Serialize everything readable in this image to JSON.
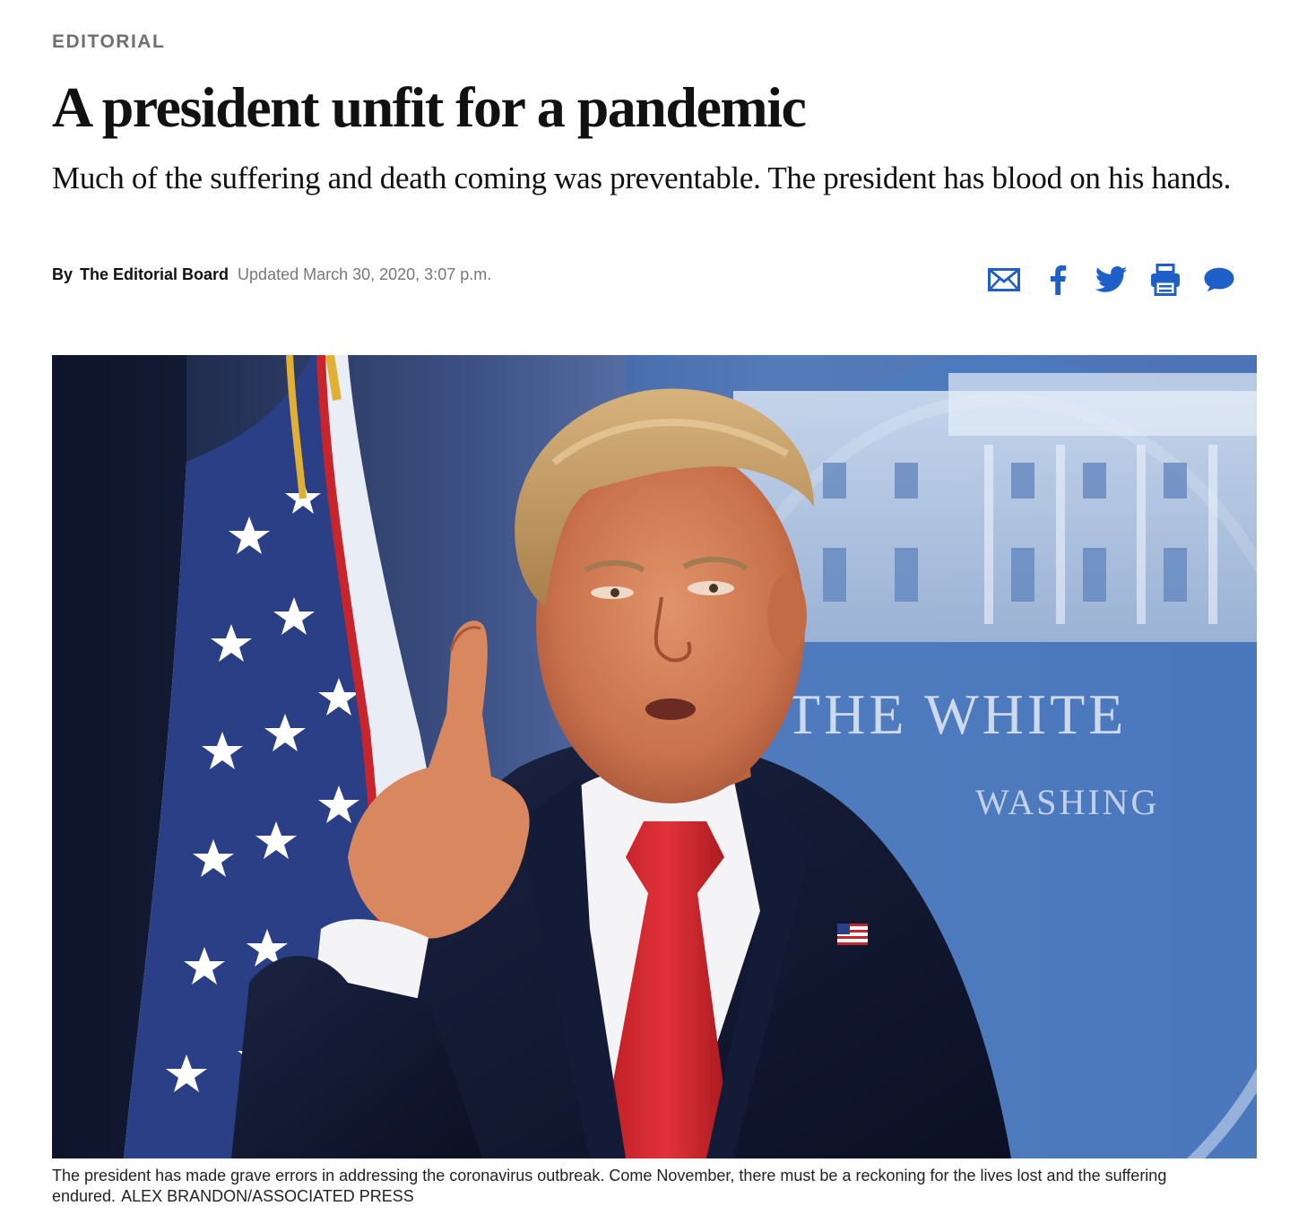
{
  "article": {
    "section": "Editorial",
    "headline": "A president unfit for a pandemic",
    "subheadline": "Much of the suffering and death coming was preventable. The president has blood on his hands.",
    "byline": {
      "prefix": "By",
      "author": "The Editorial Board",
      "updated": "Updated March 30, 2020, 3:07 p.m."
    }
  },
  "share": {
    "accent_color": "#1f5fc8",
    "buttons": [
      {
        "name": "email",
        "icon": "envelope-icon"
      },
      {
        "name": "facebook",
        "icon": "facebook-icon"
      },
      {
        "name": "twitter",
        "icon": "twitter-icon"
      },
      {
        "name": "print",
        "icon": "printer-icon"
      },
      {
        "name": "comments",
        "icon": "speech-bubble-icon"
      }
    ]
  },
  "photo": {
    "backdrop_line1": "THE WHITE",
    "backdrop_line2": "WASHING",
    "caption": "The president has made grave errors in addressing the coronavirus outbreak. Come November, there must be a reckoning for the lives lost and the suffering endured.",
    "credit": "ALEX BRANDON/ASSOCIATED PRESS"
  }
}
